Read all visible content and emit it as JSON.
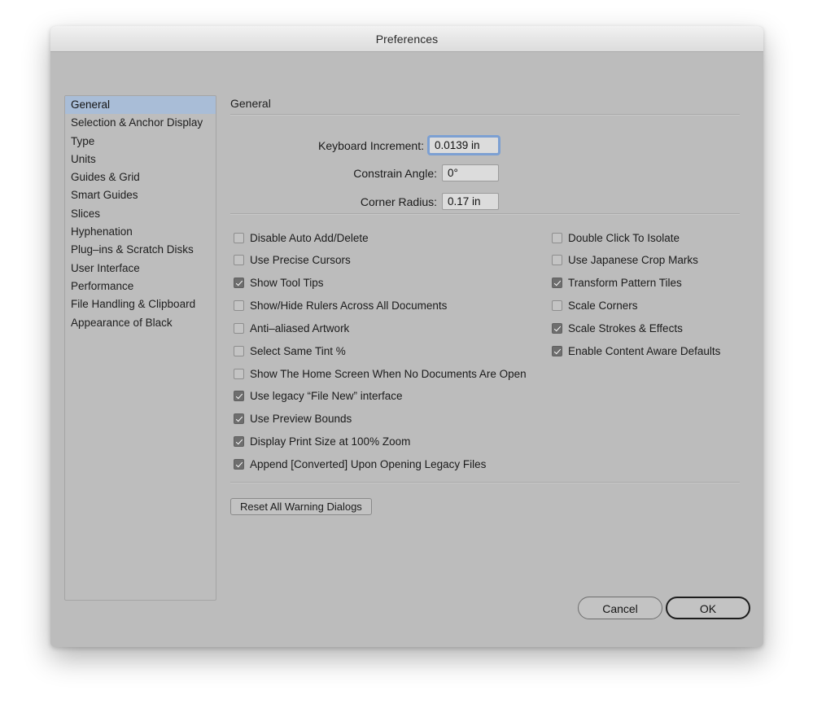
{
  "window": {
    "title": "Preferences"
  },
  "sidebar": {
    "items": [
      {
        "label": "General",
        "selected": true
      },
      {
        "label": "Selection & Anchor Display",
        "selected": false
      },
      {
        "label": "Type",
        "selected": false
      },
      {
        "label": "Units",
        "selected": false
      },
      {
        "label": "Guides & Grid",
        "selected": false
      },
      {
        "label": "Smart Guides",
        "selected": false
      },
      {
        "label": "Slices",
        "selected": false
      },
      {
        "label": "Hyphenation",
        "selected": false
      },
      {
        "label": "Plug–ins & Scratch Disks",
        "selected": false
      },
      {
        "label": "User Interface",
        "selected": false
      },
      {
        "label": "Performance",
        "selected": false
      },
      {
        "label": "File Handling & Clipboard",
        "selected": false
      },
      {
        "label": "Appearance of Black",
        "selected": false
      }
    ]
  },
  "pane": {
    "title": "General",
    "fields": [
      {
        "label": "Keyboard Increment:",
        "value": "0.0139 in",
        "focused": true
      },
      {
        "label": "Constrain Angle:",
        "value": "0°",
        "focused": false
      },
      {
        "label": "Corner Radius:",
        "value": "0.17 in",
        "focused": false
      }
    ],
    "checkboxes_left": [
      {
        "label": "Disable Auto Add/Delete",
        "checked": false
      },
      {
        "label": "Use Precise Cursors",
        "checked": false
      },
      {
        "label": "Show Tool Tips",
        "checked": true
      },
      {
        "label": "Show/Hide Rulers Across All Documents",
        "checked": false
      },
      {
        "label": "Anti–aliased Artwork",
        "checked": false
      },
      {
        "label": "Select Same Tint %",
        "checked": false
      },
      {
        "label": "Show The Home Screen When No Documents Are Open",
        "checked": false
      },
      {
        "label": "Use legacy “File New” interface",
        "checked": true
      },
      {
        "label": "Use Preview Bounds",
        "checked": true
      },
      {
        "label": "Display Print Size at 100% Zoom",
        "checked": true
      },
      {
        "label": "Append [Converted] Upon Opening Legacy Files",
        "checked": true
      }
    ],
    "checkboxes_right": [
      {
        "label": "Double Click To Isolate",
        "checked": false
      },
      {
        "label": "Use Japanese Crop Marks",
        "checked": false
      },
      {
        "label": "Transform Pattern Tiles",
        "checked": true
      },
      {
        "label": "Scale Corners",
        "checked": false
      },
      {
        "label": "Scale Strokes & Effects",
        "checked": true
      },
      {
        "label": "Enable Content Aware Defaults",
        "checked": true
      }
    ],
    "reset_button": "Reset All Warning Dialogs"
  },
  "footer": {
    "cancel_label": "Cancel",
    "ok_label": "OK"
  },
  "colors": {
    "dialog_bg": "#bcbcbc",
    "selection_blue": "#a9bdd7",
    "focus_ring": "#6496dc",
    "checked_box": "#6e6e6e",
    "titlebar_top": "#f2f2f2"
  }
}
